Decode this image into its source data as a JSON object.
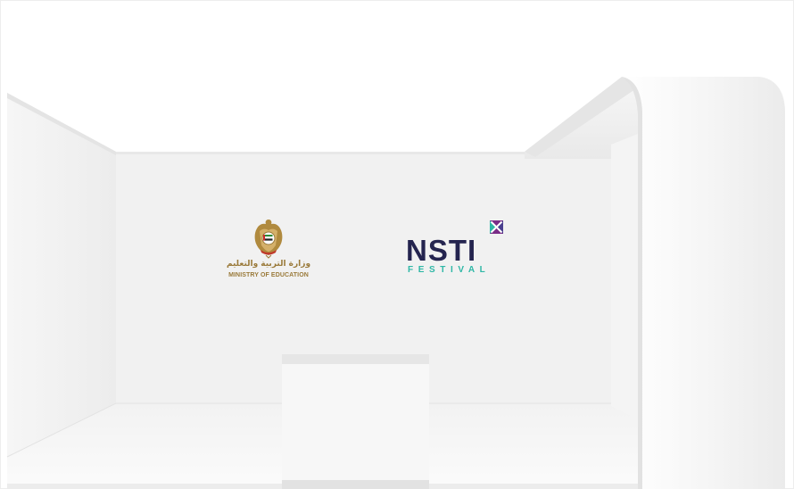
{
  "scene": {
    "description_hidden": false
  },
  "logos": {
    "ministry": {
      "arabic_text": "وزارة التربية والتعليم",
      "english_text": "MINISTRY OF EDUCATION",
      "emblem_icon": "uae-falcon-emblem-icon"
    },
    "nsti": {
      "wordmark": "NSTI",
      "subtitle": "FESTIVAL",
      "mark_icon": "x-square-icon"
    }
  },
  "colors": {
    "moe_gold": "#9a7a3a",
    "nsti_navy": "#24244f",
    "nsti_teal": "#2fb7a6",
    "nsti_purple": "#7a2d87"
  }
}
